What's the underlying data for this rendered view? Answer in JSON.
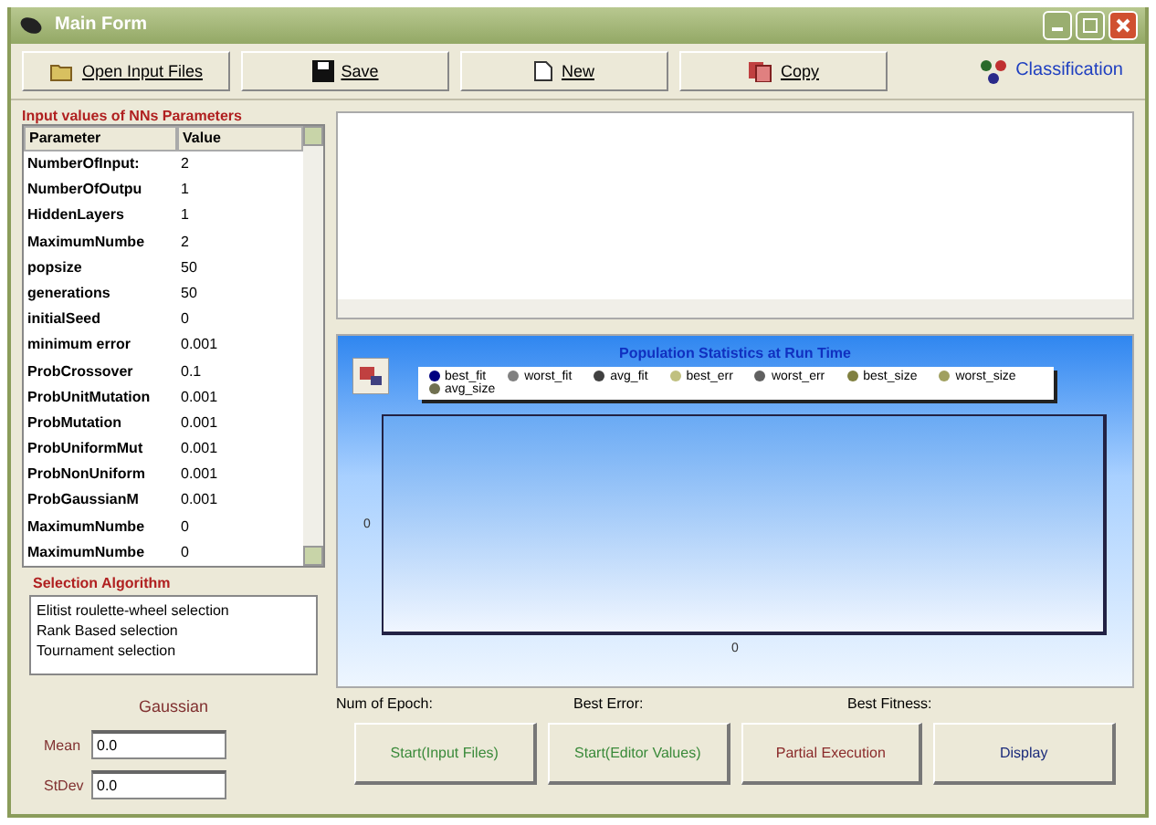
{
  "window": {
    "title": "Main Form"
  },
  "toolbar": [
    {
      "label": "Open Input Files",
      "kind": "folder"
    },
    {
      "label": "Save",
      "kind": "disk"
    },
    {
      "label": "New",
      "kind": "page"
    },
    {
      "label": "Copy",
      "kind": "copy"
    }
  ],
  "classification": {
    "label": "Classification"
  },
  "parameters": {
    "heading": "Input values of NNs Parameters",
    "columns": [
      "Parameter",
      "Value"
    ],
    "rows": [
      {
        "name": "NumberOfInput:",
        "value": "2"
      },
      {
        "name": "NumberOfOutpu",
        "value": "1"
      },
      {
        "name": "HiddenLayers",
        "value": "1"
      },
      {
        "name": "MaximumNumbe",
        "value": "2"
      },
      {
        "name": "popsize",
        "value": "50"
      },
      {
        "name": "generations",
        "value": "50"
      },
      {
        "name": "initialSeed",
        "value": "0"
      },
      {
        "name": "minimum error",
        "value": "0.001"
      },
      {
        "name": "ProbCrossover",
        "value": "0.1"
      },
      {
        "name": "ProbUnitMutation",
        "value": "0.001"
      },
      {
        "name": "ProbMutation",
        "value": "0.001"
      },
      {
        "name": "ProbUniformMut",
        "value": "0.001"
      },
      {
        "name": "ProbNonUniform",
        "value": "0.001"
      },
      {
        "name": "ProbGaussianM",
        "value": "0.001"
      },
      {
        "name": "MaximumNumbe",
        "value": "0"
      },
      {
        "name": "MaximumNumbe",
        "value": "0"
      }
    ]
  },
  "selection": {
    "heading": "Selection Algorithm",
    "items": [
      "Elitist roulette-wheel selection",
      "Rank Based selection",
      "Tournament selection"
    ]
  },
  "gaussian": {
    "heading": "Gaussian",
    "fields": [
      {
        "label": "Mean",
        "value": "0.0"
      },
      {
        "label": "StDev",
        "value": "0.0"
      }
    ]
  },
  "chart": {
    "title": "Population Statistics at Run Time",
    "legend": [
      {
        "label": "best_fit",
        "color": "#000080"
      },
      {
        "label": "worst_fit",
        "color": "#808080"
      },
      {
        "label": "avg_fit",
        "color": "#404040"
      },
      {
        "label": "best_err",
        "color": "#c0c080"
      },
      {
        "label": "worst_err",
        "color": "#606060"
      },
      {
        "label": "best_size",
        "color": "#808040"
      },
      {
        "label": "worst_size",
        "color": "#a0a060"
      },
      {
        "label": "avg_size",
        "color": "#707050"
      }
    ],
    "y_tick": "0",
    "x_tick": "0"
  },
  "stats": [
    "Num of Epoch:",
    "Best Error:",
    "Best Fitness:"
  ],
  "actions": [
    {
      "label": "Start(Input Files)",
      "kind": "green"
    },
    {
      "label": "Start(Editor Values)",
      "kind": "green"
    },
    {
      "label": "Partial Execution",
      "kind": "red"
    },
    {
      "label": "Display",
      "kind": "blue"
    }
  ]
}
